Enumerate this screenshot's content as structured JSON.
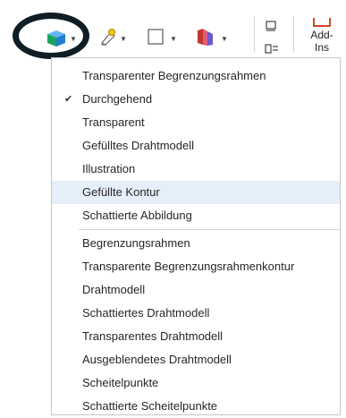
{
  "toolbar": {
    "addins_label": "Add-Ins",
    "addins_line1": "Add-",
    "addins_line2": "Ins"
  },
  "menu": {
    "group1": [
      {
        "label": "Transparenter Begrenzungsrahmen",
        "checked": false,
        "hover": false
      },
      {
        "label": "Durchgehend",
        "checked": true,
        "hover": false
      },
      {
        "label": "Transparent",
        "checked": false,
        "hover": false
      },
      {
        "label": "Gefülltes Drahtmodell",
        "checked": false,
        "hover": false
      },
      {
        "label": "Illustration",
        "checked": false,
        "hover": false
      },
      {
        "label": "Gefüllte Kontur",
        "checked": false,
        "hover": true
      },
      {
        "label": "Schattierte Abbildung",
        "checked": false,
        "hover": false
      }
    ],
    "group2": [
      {
        "label": "Begrenzungsrahmen"
      },
      {
        "label": "Transparente Begrenzungsrahmenkontur"
      },
      {
        "label": "Drahtmodell"
      },
      {
        "label": "Schattiertes Drahtmodell"
      },
      {
        "label": "Transparentes Drahtmodell"
      },
      {
        "label": "Ausgeblendetes Drahtmodell"
      },
      {
        "label": "Scheitelpunkte"
      },
      {
        "label": "Schattierte Scheitelpunkte"
      }
    ]
  },
  "colors": {
    "hover_bg": "#e5eff9",
    "ring": "#0f1d26",
    "cube_front": "#1e7fd0",
    "cube_side": "#1aa35a",
    "addins_accent": "#d24726"
  }
}
